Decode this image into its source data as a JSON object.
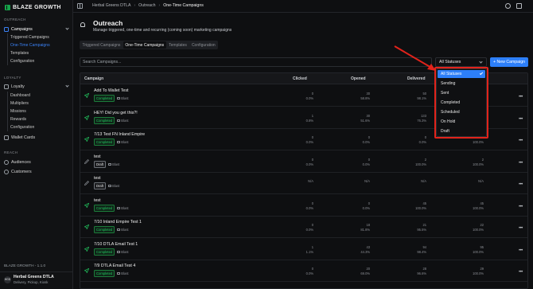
{
  "brand": {
    "name": "BLAZE GROWTH"
  },
  "breadcrumb": [
    "Herbal Greens DTLA",
    "Outreach",
    "One-Time Campaigns"
  ],
  "sidebar": {
    "section_outreach": "OUTREACH",
    "campaigns": "Campaigns",
    "campaigns_sub": [
      "Triggered Campaigns",
      "One-Time Campaigns",
      "Templates",
      "Configuration"
    ],
    "section_loyalty": "LOYALTY",
    "loyalty": "Loyalty",
    "loyalty_sub": [
      "Dashboard",
      "Multipliers",
      "Missions",
      "Rewards",
      "Configuration"
    ],
    "wallet_cards": "Wallet Cards",
    "section_reach": "REACH",
    "audiences": "Audiences",
    "customers": "Customers",
    "version": "BLAZE GROWTH - 1.1.0",
    "store_avatar": "HGD",
    "store_name": "Herbal Greens DTLA",
    "store_sub": "Delivery, Pickup, Kiosk"
  },
  "header": {
    "title": "Outreach",
    "subtitle": "Manage triggered, one-time and recurring (coming soon) marketing campaigns"
  },
  "tabs": [
    "Triggered Campaigns",
    "One-Time Campaigns",
    "Templates",
    "Configuration"
  ],
  "search": {
    "placeholder": "Search Campaigns..."
  },
  "status_filter": {
    "value": "All Statuses",
    "options": [
      "All Statuses",
      "Sending",
      "Sent",
      "Completed",
      "Scheduled",
      "On Hold",
      "Draft"
    ]
  },
  "new_campaign_label": "+ New Campaign",
  "table": {
    "headers": [
      "Campaign",
      "Clicked",
      "Opened",
      "Delivered"
    ],
    "rows": [
      {
        "name": "Add To Wallet Test",
        "status": "Completed",
        "channels": "Blast",
        "clicked": [
          "0",
          "0.0%"
        ],
        "opened": [
          "30",
          "58.8%"
        ],
        "delivered": [
          "50",
          "98.1%"
        ],
        "last": [
          "",
          ""
        ],
        "icon": "send"
      },
      {
        "name": "HEY! Did you get this?!",
        "status": "Completed",
        "channels": "Blast",
        "clicked": [
          "1",
          "0.8%"
        ],
        "opened": [
          "30",
          "51.6%"
        ],
        "delivered": [
          "133",
          "76.3%"
        ],
        "last": [
          "",
          ""
        ],
        "icon": "send"
      },
      {
        "name": "7/13 Test FN Inland Empire",
        "status": "Completed",
        "channels": "Blast",
        "clicked": [
          "0",
          "0.0%"
        ],
        "opened": [
          "0",
          "0.0%"
        ],
        "delivered": [
          "0",
          "0.0%"
        ],
        "last": [
          "0",
          "100.0%"
        ],
        "icon": "send"
      },
      {
        "name": "test",
        "status": "Draft",
        "channels": "Blast",
        "clicked": [
          "0",
          "0.0%"
        ],
        "opened": [
          "0",
          "0.0%"
        ],
        "delivered": [
          "2",
          "100.0%"
        ],
        "last": [
          "2",
          "100.0%"
        ],
        "icon": "pencil"
      },
      {
        "name": "test",
        "status": "Draft",
        "channels": "Blast",
        "clicked": [
          "N/A",
          ""
        ],
        "opened": [
          "N/A",
          ""
        ],
        "delivered": [
          "N/A",
          ""
        ],
        "last": [
          "N/A",
          ""
        ],
        "icon": "pencil"
      },
      {
        "name": "test",
        "status": "Completed",
        "channels": "Blast",
        "clicked": [
          "0",
          "0.0%"
        ],
        "opened": [
          "0",
          "0.0%"
        ],
        "delivered": [
          "45",
          "100.0%"
        ],
        "last": [
          "45",
          "100.0%"
        ],
        "icon": "send"
      },
      {
        "name": "7/10 Inland Empire Test 1",
        "status": "Completed",
        "channels": "Blast",
        "clicked": [
          "0",
          "0.0%"
        ],
        "opened": [
          "18",
          "81.8%"
        ],
        "delivered": [
          "21",
          "95.5%"
        ],
        "last": [
          "22",
          "100.0%"
        ],
        "icon": "send"
      },
      {
        "name": "7/10 DTLA Email Test 1",
        "status": "Completed",
        "channels": "Blast",
        "clicked": [
          "1",
          "1.1%"
        ],
        "opened": [
          "43",
          "44.3%"
        ],
        "delivered": [
          "94",
          "98.4%"
        ],
        "last": [
          "95",
          "100.0%"
        ],
        "icon": "send"
      },
      {
        "name": "7/9 DTLA Email Test 4",
        "status": "Completed",
        "channels": "Blast",
        "clicked": [
          "0",
          "0.0%"
        ],
        "opened": [
          "20",
          "69.0%"
        ],
        "delivered": [
          "28",
          "96.6%"
        ],
        "last": [
          "29",
          "100.0%"
        ],
        "icon": "send"
      }
    ]
  },
  "colors": {
    "accent": "#2d7ff9",
    "completed": "#22c55e",
    "highlight": "#e1231b"
  }
}
